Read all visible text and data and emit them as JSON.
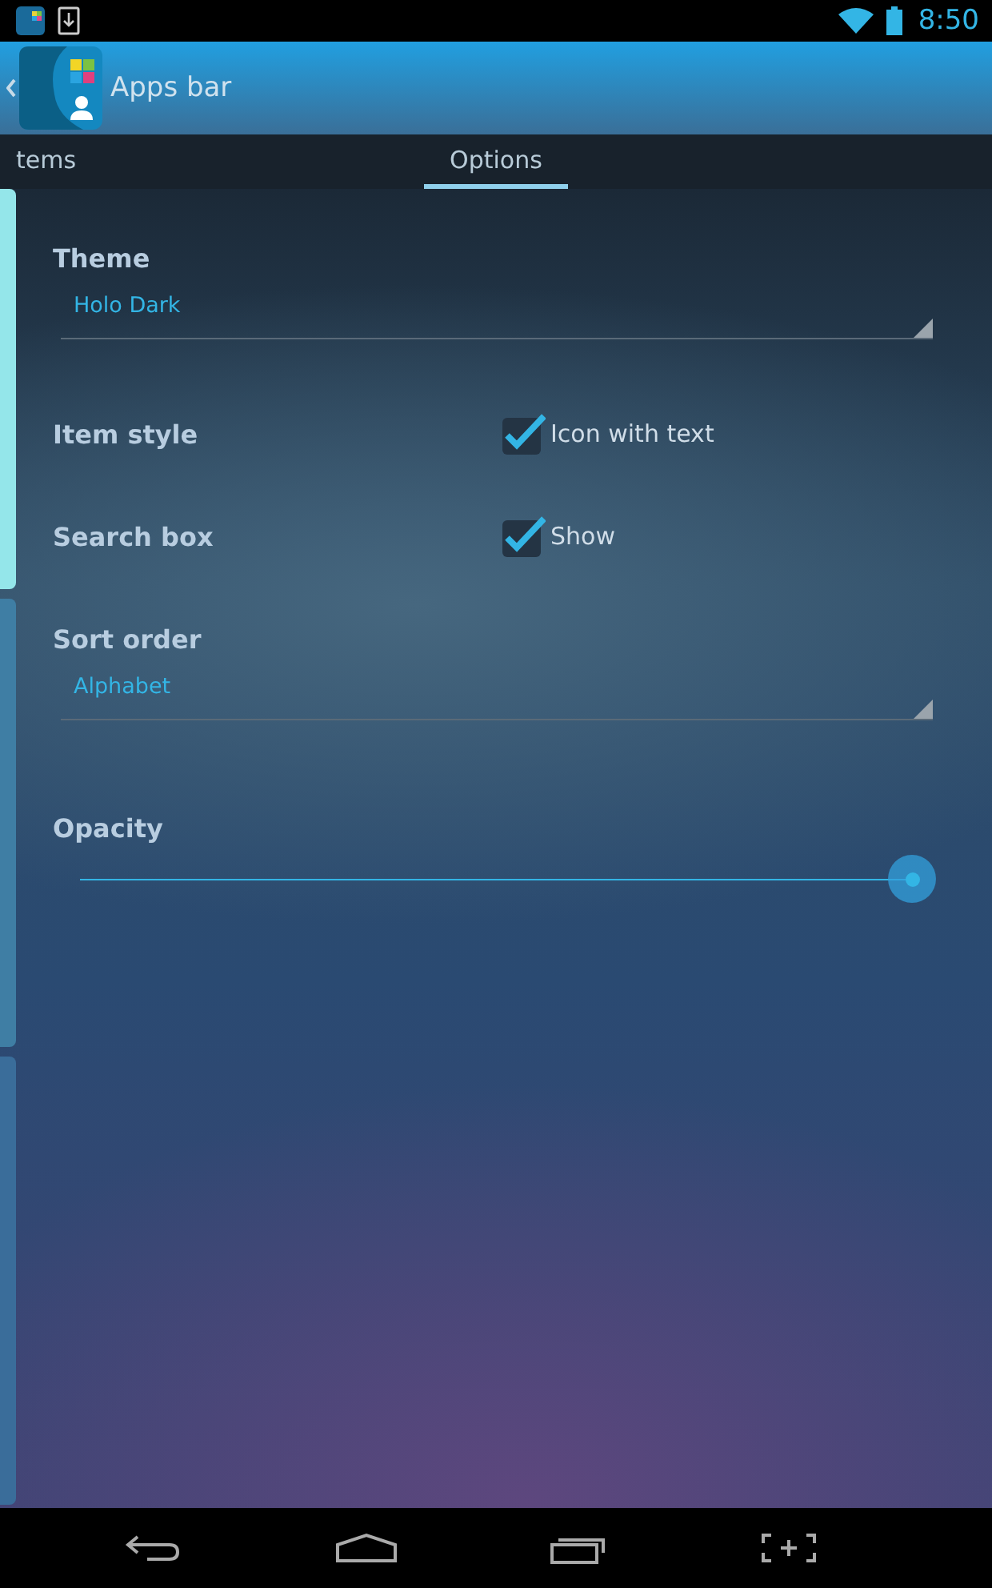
{
  "status_bar": {
    "time": "8:50"
  },
  "action_bar": {
    "title": "Apps bar"
  },
  "tabs": [
    {
      "label": "tems",
      "selected": false
    },
    {
      "label": "Options",
      "selected": true
    }
  ],
  "settings": [
    {
      "kind": "dropdown",
      "label": "Theme",
      "value": "Holo Dark"
    },
    {
      "kind": "checkbox",
      "label": "Item style",
      "option": "Icon with text",
      "checked": true
    },
    {
      "kind": "checkbox",
      "label": "Search box",
      "option": "Show",
      "checked": true
    },
    {
      "kind": "dropdown",
      "label": "Sort order",
      "value": "Alphabet"
    },
    {
      "kind": "slider",
      "label": "Opacity",
      "level": 1
    }
  ]
}
